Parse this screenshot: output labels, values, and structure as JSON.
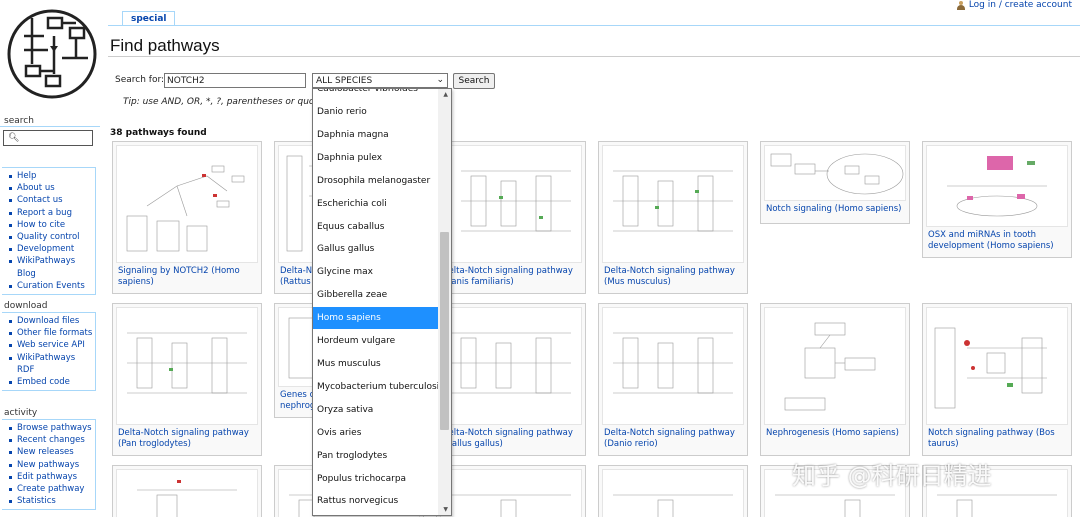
{
  "header": {
    "tab_label": "special",
    "login_link": "Log in / create account",
    "page_title": "Find pathways"
  },
  "sidebar": {
    "search_heading": "search",
    "links": [
      "Help",
      "About us",
      "Contact us",
      "Report a bug",
      "How to cite",
      "Quality control",
      "Development",
      "WikiPathways Blog",
      "Curation Events"
    ],
    "download_heading": "download",
    "download_links": [
      "Download files",
      "Other file formats",
      "Web service API",
      "WikiPathways RDF",
      "Embed code"
    ],
    "activity_heading": "activity",
    "activity_links": [
      "Browse pathways",
      "Recent changes",
      "New releases",
      "New pathways",
      "Edit pathways",
      "Create pathway",
      "Statistics"
    ]
  },
  "search": {
    "label": "Search for:",
    "query": "NOTCH2",
    "species_selected": "ALL SPECIES",
    "button": "Search",
    "tip": "Tip: use AND, OR, *, ?, parentheses or quotes"
  },
  "results": {
    "count_text": "38 pathways found",
    "cards": [
      {
        "title": "Signaling by NOTCH2 (Homo sapiens)"
      },
      {
        "title": "Delta-Notch signaling pathway (Rattus norvegicus)"
      },
      {
        "title": "Delta-Notch signaling pathway (Canis familiaris)"
      },
      {
        "title": "Delta-Notch signaling pathway (Mus musculus)"
      },
      {
        "title": "Notch signaling (Homo sapiens)"
      },
      {
        "title": "OSX and miRNAs in tooth development (Homo sapiens)"
      },
      {
        "title": "Delta-Notch signaling pathway (Pan troglodytes)"
      },
      {
        "title": "Genes controlling nephrogenesis (Homo sapiens)"
      },
      {
        "title": "Delta-Notch signaling pathway (Gallus gallus)"
      },
      {
        "title": "Delta-Notch signaling pathway (Danio rerio)"
      },
      {
        "title": "Nephrogenesis (Homo sapiens)"
      },
      {
        "title": "Notch signaling pathway (Bos taurus)"
      }
    ]
  },
  "species_dropdown": {
    "options": [
      "Caulobacter vibrioides",
      "Danio rerio",
      "Daphnia magna",
      "Daphnia pulex",
      "Drosophila melanogaster",
      "Escherichia coli",
      "Equus caballus",
      "Gallus gallus",
      "Glycine max",
      "Gibberella zeae",
      "Homo sapiens",
      "Hordeum vulgare",
      "Mus musculus",
      "Mycobacterium tuberculosis",
      "Oryza sativa",
      "Ovis aries",
      "Pan troglodytes",
      "Populus trichocarpa",
      "Rattus norvegicus"
    ],
    "highlighted": "Homo sapiens"
  },
  "watermark": "知乎 @科研日精进",
  "colors": {
    "link": "#0645ad",
    "highlight": "#1e90ff",
    "tab_border": "#a7d7f9"
  }
}
